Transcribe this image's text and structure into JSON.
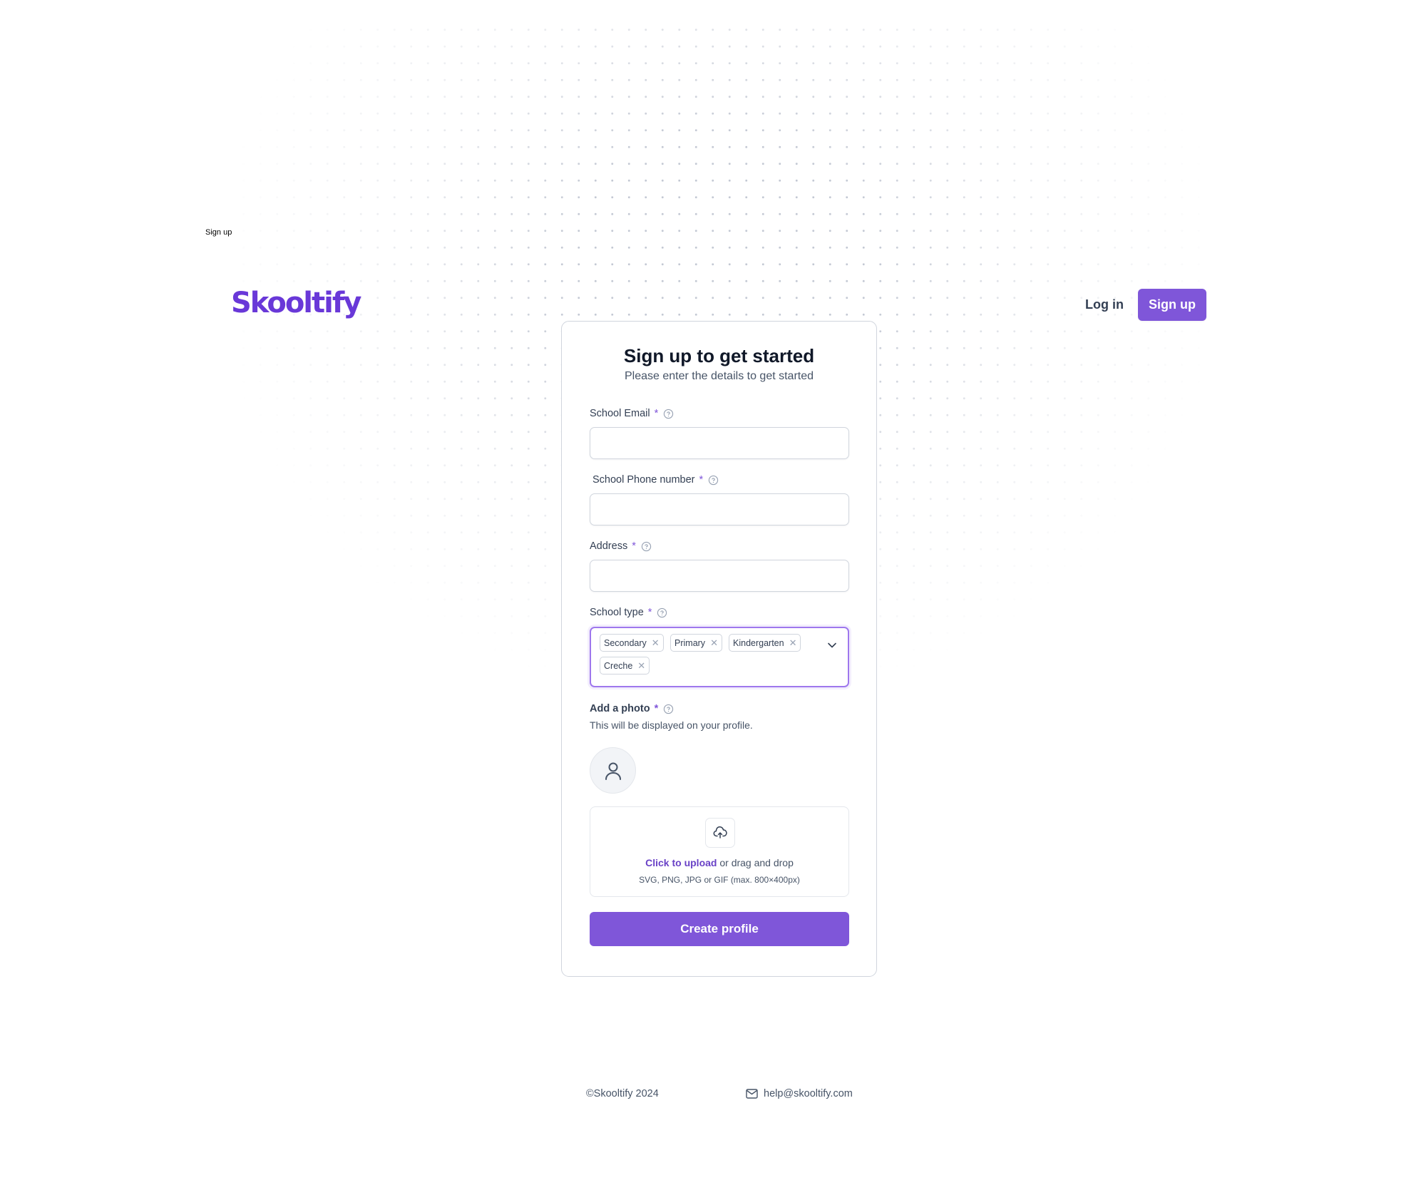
{
  "page_tag": "Sign up",
  "brand": {
    "logo_text": "Skooltify",
    "accent_color": "#7f56d9"
  },
  "header": {
    "login_label": "Log in",
    "signup_label": "Sign up"
  },
  "form": {
    "title": "Sign up to get started",
    "subtitle": "Please enter the details to get started",
    "required_mark": "*",
    "email": {
      "label": "School Email",
      "value": "",
      "icon": "help-circle-icon"
    },
    "phone": {
      "label": "School Phone number",
      "value": "",
      "icon": "help-circle-icon"
    },
    "address": {
      "label": "Address",
      "value": "",
      "icon": "help-circle-icon"
    },
    "school_type": {
      "label": "School type",
      "selected": [
        "Secondary",
        "Primary",
        "Kindergarten",
        "Creche"
      ],
      "remove_glyph": "✕",
      "icon": "chevron-down-icon"
    },
    "photo": {
      "label": "Add a photo",
      "description": "This will be displayed on your profile.",
      "avatar_icon": "user-icon"
    },
    "upload": {
      "icon": "cloud-upload-icon",
      "link_text": "Click to upload",
      "rest_text": " or drag and drop",
      "hint": "SVG, PNG, JPG or GIF (max. 800×400px)"
    },
    "submit_label": "Create profile"
  },
  "footer": {
    "copyright": "©Skooltify 2024",
    "email": "help@skooltify.com",
    "email_icon": "mail-icon"
  }
}
